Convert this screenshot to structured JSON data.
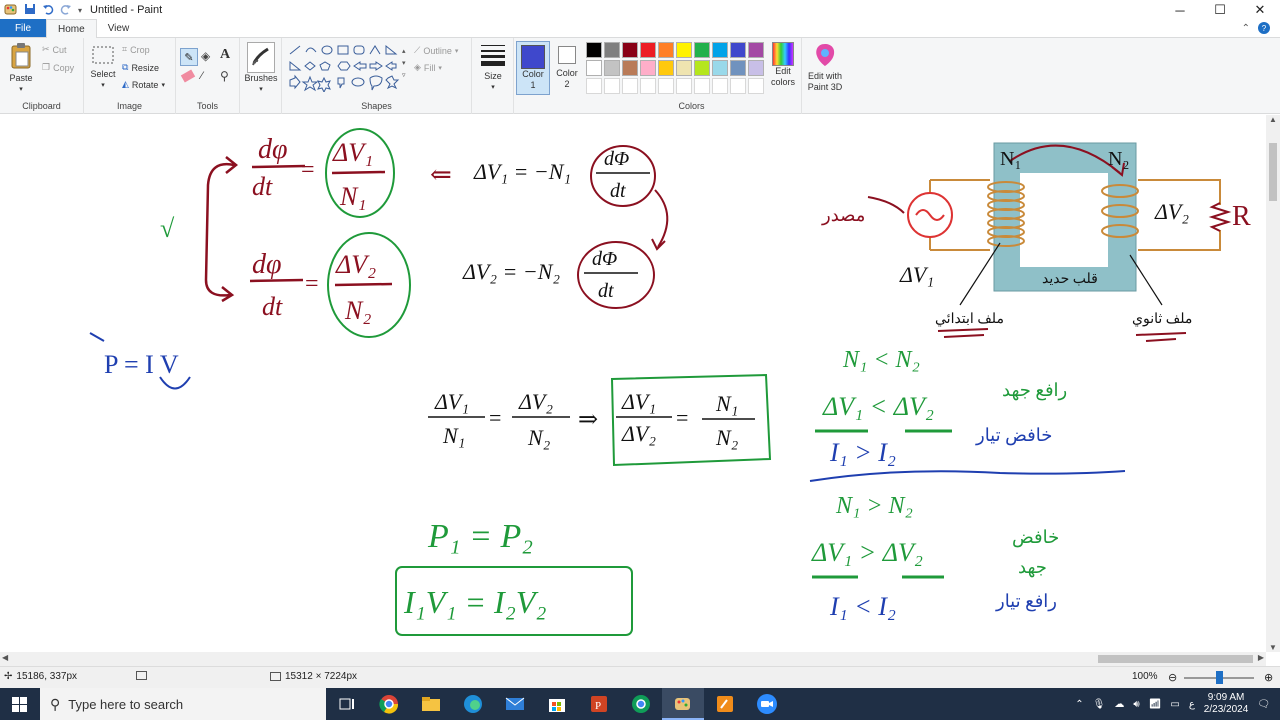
{
  "window": {
    "title": "Untitled - Paint",
    "controls": {
      "minimize": "─",
      "maximize": "☐",
      "close": "✕"
    }
  },
  "tabs": [
    {
      "label": "File"
    },
    {
      "label": "Home"
    },
    {
      "label": "View"
    }
  ],
  "ribbon": {
    "clipboard": {
      "label": "Clipboard",
      "paste": "Paste",
      "cut": "Cut",
      "copy": "Copy"
    },
    "image": {
      "label": "Image",
      "select": "Select",
      "crop": "Crop",
      "resize": "Resize",
      "rotate": "Rotate"
    },
    "tools": {
      "label": "Tools"
    },
    "brushes": {
      "label": "Brushes"
    },
    "shapes": {
      "label": "Shapes",
      "outline": "Outline",
      "fill": "Fill"
    },
    "size": {
      "label": "Size"
    },
    "color1": {
      "label_line1": "Color",
      "label_line2": "1",
      "value": "#3f48cc"
    },
    "color2": {
      "label_line1": "Color",
      "label_line2": "2",
      "value": "#ffffff"
    },
    "colors": {
      "label": "Colors",
      "row1": [
        "#000000",
        "#7f7f7f",
        "#880015",
        "#ed1c24",
        "#ff7f27",
        "#fff200",
        "#22b14c",
        "#00a2e8",
        "#3f48cc",
        "#a349a4"
      ],
      "row2": [
        "#ffffff",
        "#c3c3c3",
        "#b97a57",
        "#ffaec9",
        "#ffc90e",
        "#efe4b0",
        "#b5e61d",
        "#99d9ea",
        "#7092be",
        "#c8bfe7"
      ]
    },
    "edit_colors": {
      "line1": "Edit",
      "line2": "colors"
    },
    "paint3d": {
      "line1": "Edit with",
      "line2": "Paint 3D"
    }
  },
  "canvas": {
    "left_formulas": {
      "flux1_num": "dφ",
      "flux1_den": "dt",
      "ratio1_num": "ΔV₁",
      "ratio1_den": "N₁",
      "flux2_num": "dφ",
      "flux2_den": "dt",
      "ratio2_num": "ΔV₂",
      "ratio2_den": "N₂",
      "check": "√"
    },
    "faraday": {
      "eq1_lhs": "ΔV₁ = −N₁",
      "eq1_frac_num": "dΦ",
      "eq1_frac_den": "dt",
      "arrow": "⇐",
      "eq2_lhs": "ΔV₂ = −N₂",
      "eq2_frac_num": "dΦ",
      "eq2_frac_den": "dt"
    },
    "power": {
      "eq": "P = I V"
    },
    "ratio_eq": {
      "a_num": "ΔV₁",
      "a_den": "N₁",
      "b_num": "ΔV₂",
      "b_den": "N₂",
      "imply": "⇒",
      "c_num": "ΔV₁",
      "c_den": "ΔV₂",
      "d_num": "N₁",
      "d_den": "N₂",
      "eq": "="
    },
    "power_eq": {
      "line1": "P₁ = P₂",
      "line2": "I₁V₁ = I₂V₂"
    },
    "transformer": {
      "n1": "N₁",
      "n2": "N₂",
      "dv1": "ΔV₁",
      "dv2": "ΔV₂",
      "r": "R",
      "source": "مصدر",
      "core": "قلب حديد",
      "primary": "ملف ابتدائي",
      "secondary": "ملف ثانوي"
    },
    "stepup": {
      "line1": "N₁ < N₂",
      "line2": "ΔV₁ < ΔV₂",
      "line3": "I₁ > I₂",
      "note1": "رافع جهد",
      "note2": "خافض تيار"
    },
    "stepdown": {
      "line1": "N₁ > N₂",
      "line2": "ΔV₁ > ΔV₂",
      "line3": "I₁ < I₂",
      "note1": "خافض",
      "note2": "جهد",
      "note3": "رافع تيار"
    }
  },
  "statusbar": {
    "cursor": "15186, 337px",
    "dimensions": "15312 × 7224px",
    "zoom": "100%",
    "zoom_level": 0.5
  },
  "taskbar": {
    "search_placeholder": "Type here to search",
    "time": "9:09 AM",
    "date": "2/23/2024",
    "lang": "ع"
  }
}
